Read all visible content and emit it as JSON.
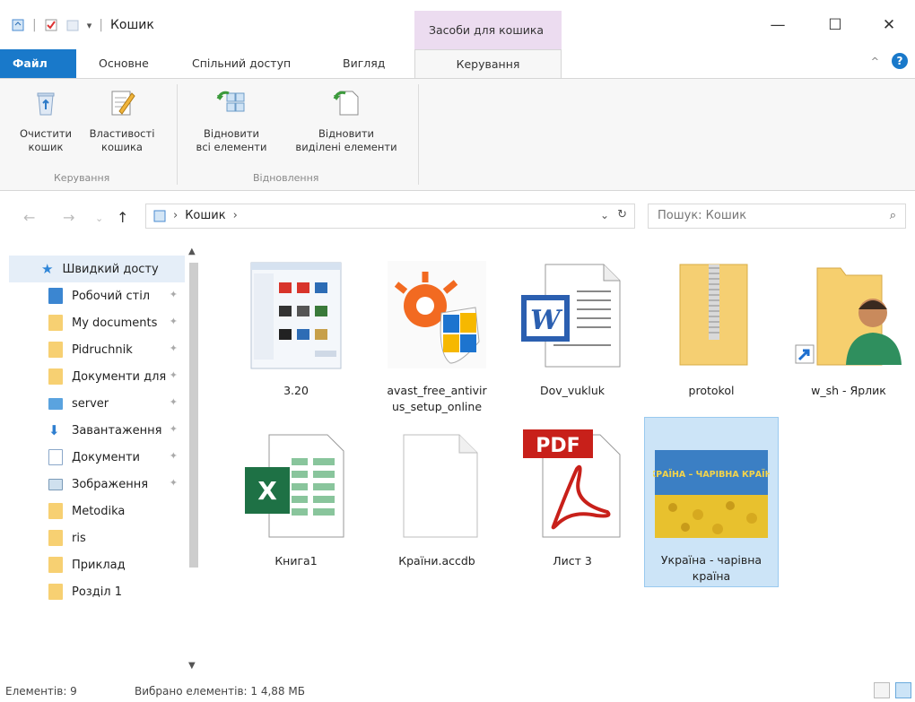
{
  "window": {
    "title": "Кошик",
    "context_tab_group": "Засоби для кошика",
    "controls": [
      "—",
      "☐",
      "✕"
    ]
  },
  "ribbon": {
    "tabs": [
      "Файл",
      "Основне",
      "Спільний доступ",
      "Вигляд",
      "Керування"
    ],
    "active_tab": "Керування",
    "groups": [
      {
        "label": "Керування",
        "buttons": [
          {
            "line1": "Очистити",
            "line2": "кошик",
            "icon": "empty-bin-icon"
          },
          {
            "line1": "Властивості",
            "line2": "кошика",
            "icon": "properties-icon"
          }
        ]
      },
      {
        "label": "Відновлення",
        "buttons": [
          {
            "line1": "Відновити",
            "line2": "всі елементи",
            "icon": "restore-all-icon"
          },
          {
            "line1": "Відновити",
            "line2": "виділені елементи",
            "icon": "restore-selected-icon"
          }
        ]
      }
    ]
  },
  "address": {
    "breadcrumb": [
      "Кошик"
    ],
    "search_placeholder": "Пошук: Кошик"
  },
  "nav": {
    "items": [
      {
        "label": "Швидкий доступ",
        "icon": "star-icon",
        "pinned": false,
        "selected": true
      },
      {
        "label": "Робочий стіл",
        "icon": "desktop-icon",
        "pinned": true
      },
      {
        "label": "My documents",
        "icon": "folder-icon",
        "pinned": true
      },
      {
        "label": "Pidruchnik",
        "icon": "folder-icon",
        "pinned": true
      },
      {
        "label": "Документи для",
        "icon": "folder-icon",
        "pinned": true
      },
      {
        "label": "server",
        "icon": "monitor-icon",
        "pinned": true
      },
      {
        "label": "Завантаження",
        "icon": "download-icon",
        "pinned": true
      },
      {
        "label": "Документи",
        "icon": "documents-icon",
        "pinned": true
      },
      {
        "label": "Зображення",
        "icon": "pictures-icon",
        "pinned": true
      },
      {
        "label": "Metodika",
        "icon": "folder-icon",
        "pinned": false
      },
      {
        "label": "ris",
        "icon": "folder-icon",
        "pinned": false
      },
      {
        "label": "Приклад",
        "icon": "folder-icon",
        "pinned": false
      },
      {
        "label": "Розділ 1",
        "icon": "folder-icon",
        "pinned": false
      }
    ]
  },
  "files": [
    {
      "name": "3.20",
      "icon": "screenshot-thumb"
    },
    {
      "name": "avast_free_antivir us_setup_online",
      "icon": "avast-installer-icon"
    },
    {
      "name": "Dov_vukluk",
      "icon": "word-document-icon"
    },
    {
      "name": "protokol",
      "icon": "zip-folder-icon"
    },
    {
      "name": "w_sh - Ярлик",
      "icon": "user-folder-shortcut-icon"
    },
    {
      "name": "Книга1",
      "icon": "excel-workbook-icon"
    },
    {
      "name": "Країни.accdb",
      "icon": "blank-file-icon"
    },
    {
      "name": "Лист 3",
      "icon": "pdf-icon"
    },
    {
      "name": "Україна - чарівна країна",
      "icon": "image-thumb",
      "selected": true,
      "thumb_text": "УКРАЇНА – ЧАРІВНА КРАЇНА"
    }
  ],
  "status": {
    "count": "Елементів: 9",
    "selection": "Вибрано елементів: 1  4,88 МБ"
  },
  "colors": {
    "accent": "#1979ca",
    "context_tab": "#ecdcf0",
    "selection": "#cce4f7",
    "folder": "#f7d072"
  }
}
